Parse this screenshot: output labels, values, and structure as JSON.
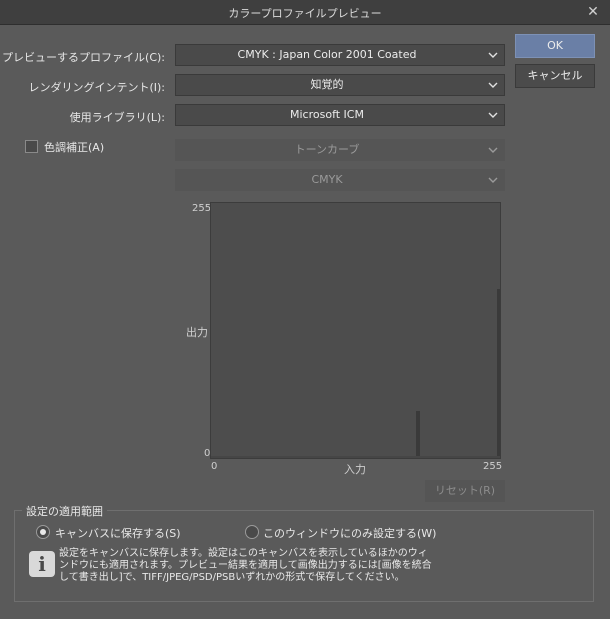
{
  "window": {
    "title": "カラープロファイルプレビュー",
    "close": "✕"
  },
  "preview_profile": {
    "label": "プレビューするプロファイル(C):",
    "value": "CMYK : Japan Color 2001 Coated"
  },
  "rendering_intent": {
    "label": "レンダリングインテント(I):",
    "value": "知覚的"
  },
  "library": {
    "label": "使用ライブラリ(L):",
    "value": "Microsoft ICM"
  },
  "color_correction": {
    "label": "色調補正(A)",
    "checked": false
  },
  "tone_curve": {
    "value": "トーンカーブ"
  },
  "channel": {
    "value": "CMYK"
  },
  "graph": {
    "y_max": "255",
    "y_min": "0",
    "y_label": "出力",
    "x_min": "0",
    "x_max": "255",
    "x_label": "入力"
  },
  "buttons": {
    "ok": "OK",
    "cancel": "キャンセル",
    "reset": "リセット(R)"
  },
  "scope": {
    "title": "設定の適用範囲",
    "save_canvas": "キャンバスに保存する(S)",
    "window_only": "このウィンドウにのみ設定する(W)",
    "selected": "save_canvas"
  },
  "info": {
    "icon": "info-icon",
    "line1": "設定をキャンバスに保存します。設定はこのキャンバスを表示しているほかのウィ",
    "line2": "ンドウにも適用されます。プレビュー結果を適用して画像出力するには[画像を統合",
    "line3": "して書き出し]で、TIFF/JPEG/PSD/PSBいずれかの形式で保存してください。"
  },
  "colors": {
    "primary": "#6a7fa6",
    "background": "#5a5a5a"
  }
}
